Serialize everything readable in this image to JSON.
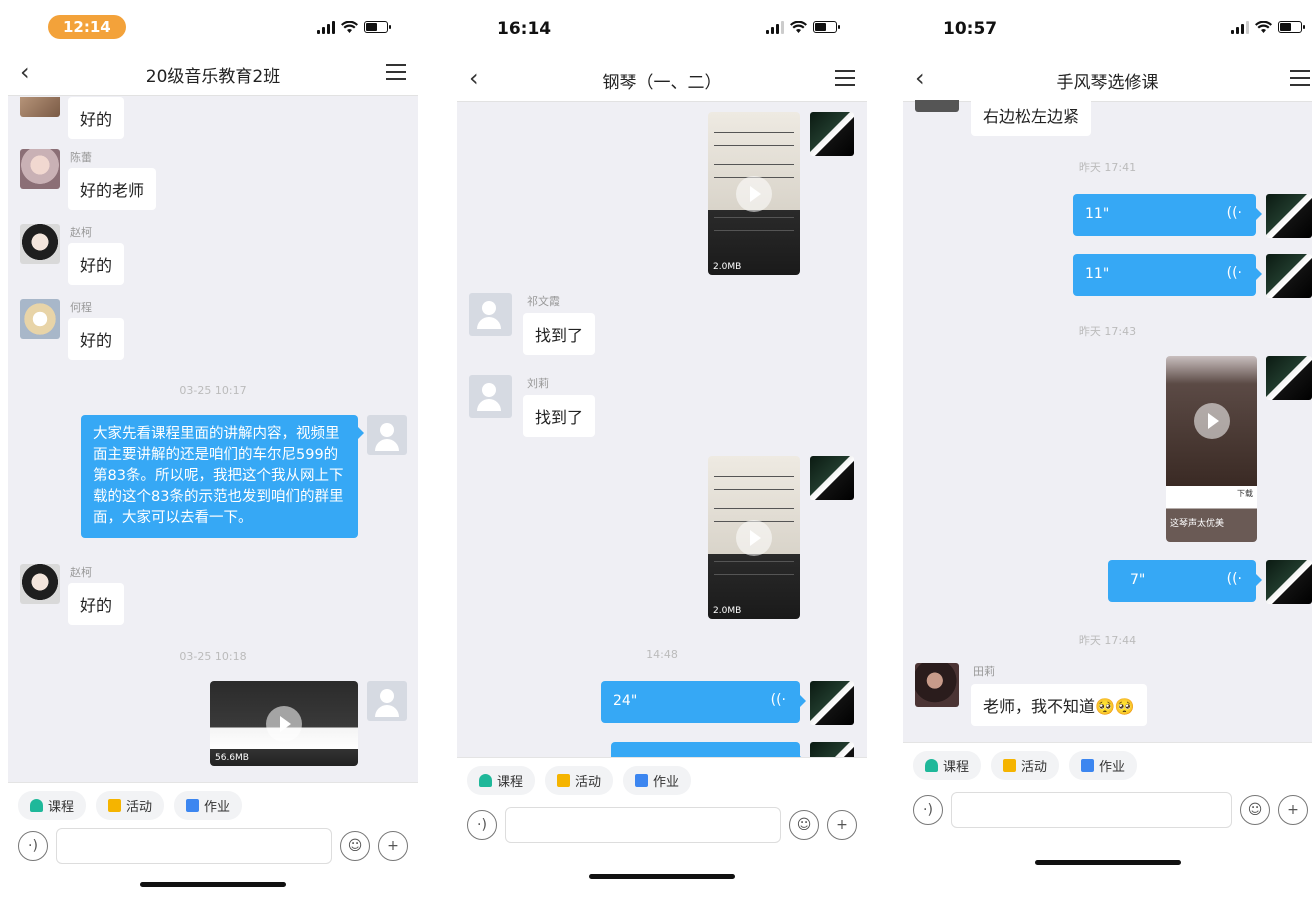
{
  "phone1": {
    "time": "12:14",
    "title": "20级音乐教育2班",
    "messages": [
      {
        "text": "好的"
      },
      {
        "name": "陈蕾",
        "text": "好的老师"
      },
      {
        "name": "赵柯",
        "text": "好的"
      },
      {
        "name": "何程",
        "text": "好的"
      },
      {
        "time": "03-25 10:17"
      },
      {
        "text": "大家先看课程里面的讲解内容，视频里面主要讲解的还是咱们的车尔尼599的第83条。所以呢，我把这个我从网上下载的这个83条的示范也发到咱们的群里面，大家可以去看一下。"
      },
      {
        "name": "赵柯",
        "text": "好的"
      },
      {
        "time": "03-25 10:18"
      },
      {
        "video_size": "56.6MB"
      }
    ]
  },
  "phone2": {
    "time": "16:14",
    "title": "钢琴（一、二）",
    "video1_size": "2.0MB",
    "msg1": {
      "name": "祁文霞",
      "text": "找到了"
    },
    "msg2": {
      "name": "刘莉",
      "text": "找到了"
    },
    "video2_size": "2.0MB",
    "time_stamp": "14:48",
    "voice": "24\""
  },
  "phone3": {
    "time": "10:57",
    "title": "手风琴选修课",
    "first_text": "右边松左边紧",
    "t1": "昨天 17:41",
    "voice1": "11\"",
    "voice2": "11\"",
    "t2": "昨天 17:43",
    "thumb_caption": "下载",
    "thumb_text": "这琴声太优美",
    "voice3": "7\"",
    "t3": "昨天 17:44",
    "msg": {
      "name": "田莉",
      "text": "老师，我不知道🥺🥺"
    }
  },
  "toolbar": {
    "course": "课程",
    "activity": "活动",
    "homework": "作业",
    "voice_icon": "·)"
  },
  "colors": {
    "blue": "#36a8f5",
    "orange": "#f3a23a"
  }
}
